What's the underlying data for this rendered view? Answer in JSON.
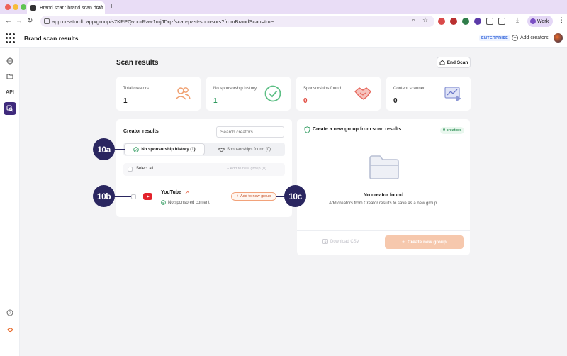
{
  "browser": {
    "tab_title": "Brand scan: brand scan draft",
    "url": "app.creatordb.app/group/s7KPPQvourRaw1mjJDqz/scan-past-sponsors?fromBrandScan=true",
    "profile_label": "Work",
    "new_tab_symbol": "+",
    "tab_close_symbol": "✕"
  },
  "header": {
    "title": "Brand scan results",
    "plan_badge": "ENTERPRISE",
    "add_creators_label": "Add creators"
  },
  "sidebar": {
    "api_label": "API"
  },
  "main": {
    "heading": "Scan results",
    "end_scan_label": "End Scan"
  },
  "stats": [
    {
      "label": "Total creators",
      "value": "1",
      "color": "#1a1a1a"
    },
    {
      "label": "No sponsorship history",
      "value": "1",
      "color": "#2f9a5e"
    },
    {
      "label": "Sponsorships found",
      "value": "0",
      "color": "#e0453a"
    },
    {
      "label": "Content scanned",
      "value": "0",
      "color": "#1a1a1a"
    }
  ],
  "creator_results": {
    "title": "Creator results",
    "search_placeholder": "Search creators...",
    "tab_active": "No sponsorship history (1)",
    "tab_inactive": "Sponsorships found (0)",
    "select_all_label": "Select all",
    "add_to_group_label": "Add to new group (0)",
    "creator": {
      "platform": "YouTube",
      "status": "No sponsored content",
      "add_button_label": "Add to new group"
    }
  },
  "group_panel": {
    "title": "Create a new group from scan results",
    "count_badge": "0 creators",
    "empty_title": "No creator found",
    "empty_description": "Add creators from Creator results to save as a new group.",
    "download_label": "Download CSV",
    "create_label": "Create new group"
  },
  "annotations": {
    "a": "10a",
    "b": "10b",
    "c": "10c"
  },
  "colors": {
    "accent_purple": "#3f2a7c",
    "marker": "#2a2660",
    "brand_orange": "#e86a2a",
    "success_green": "#2f9a5e"
  }
}
